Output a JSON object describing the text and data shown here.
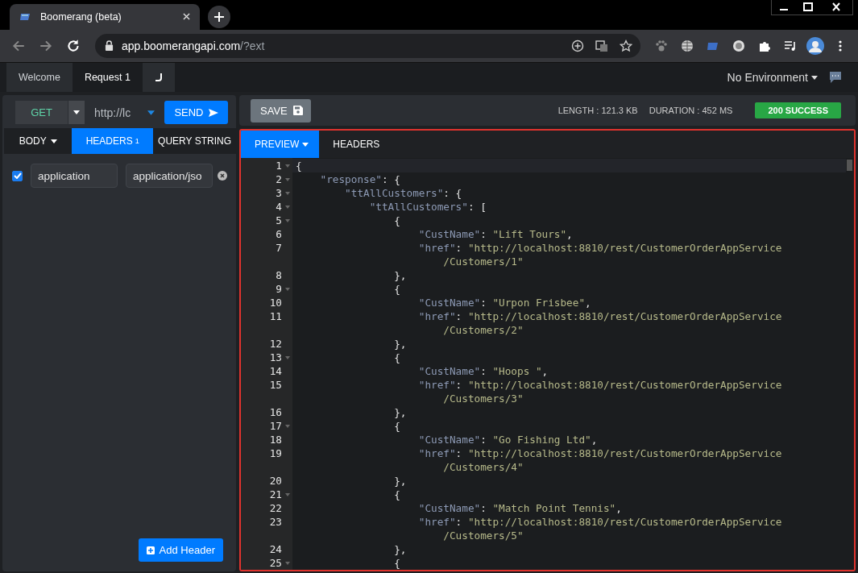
{
  "browser": {
    "tab_title": "Boomerang (beta)",
    "url_host": "app.boomerangapi.com",
    "url_path": "/?ext"
  },
  "app_tabs": [
    {
      "label": "Welcome",
      "selected": false
    },
    {
      "label": "Request 1",
      "selected": true
    }
  ],
  "environment": "No Environment",
  "request": {
    "method": "GET",
    "url": "http://lc",
    "send": "SEND",
    "tabs": [
      {
        "label": "BODY",
        "kind": "dropdown",
        "selected": false
      },
      {
        "label": "HEADERS",
        "kind": "count",
        "count": "1",
        "selected": true
      },
      {
        "label": "QUERY STRING",
        "kind": "plain",
        "selected": false
      }
    ],
    "headers": [
      {
        "checked": true,
        "name": "application",
        "value": "application/jso"
      }
    ],
    "add_header": "Add Header"
  },
  "response": {
    "save": "SAVE",
    "length": "LENGTH : 121.3 KB",
    "duration": "DURATION : 452 MS",
    "status": "200 SUCCESS",
    "tabs": [
      {
        "label": "PREVIEW",
        "selected": true
      },
      {
        "label": "HEADERS",
        "selected": false
      }
    ],
    "lines": [
      {
        "number": "1",
        "fold": true,
        "tokens": [
          {
            "kind": "punct",
            "text": "{"
          }
        ]
      },
      {
        "number": "2",
        "fold": true,
        "tokens": [
          {
            "kind": "key",
            "text": "    \"response\""
          },
          {
            "kind": "punct",
            "text": ": {"
          }
        ]
      },
      {
        "number": "3",
        "fold": true,
        "tokens": [
          {
            "kind": "key",
            "text": "        \"ttAllCustomers\""
          },
          {
            "kind": "punct",
            "text": ": {"
          }
        ]
      },
      {
        "number": "4",
        "fold": true,
        "tokens": [
          {
            "kind": "key",
            "text": "            \"ttAllCustomers\""
          },
          {
            "kind": "punct",
            "text": ": ["
          }
        ]
      },
      {
        "number": "5",
        "fold": true,
        "tokens": [
          {
            "kind": "punct",
            "text": "                {"
          }
        ]
      },
      {
        "number": "6",
        "fold": false,
        "tokens": [
          {
            "kind": "key",
            "text": "                    \"CustName\""
          },
          {
            "kind": "punct",
            "text": ": "
          },
          {
            "kind": "str",
            "text": "\"Lift Tours\""
          },
          {
            "kind": "punct",
            "text": ","
          }
        ]
      },
      {
        "number": "7",
        "fold": false,
        "tokens": [
          {
            "kind": "key",
            "text": "                    \"href\""
          },
          {
            "kind": "punct",
            "text": ": "
          },
          {
            "kind": "str",
            "text": "\"http://localhost:8810/rest/CustomerOrderAppService"
          }
        ]
      },
      {
        "fold": false,
        "tokens": [
          {
            "kind": "str",
            "text": "                        /Customers/1\""
          }
        ]
      },
      {
        "number": "8",
        "fold": false,
        "tokens": [
          {
            "kind": "punct",
            "text": "                },"
          }
        ]
      },
      {
        "number": "9",
        "fold": true,
        "tokens": [
          {
            "kind": "punct",
            "text": "                {"
          }
        ]
      },
      {
        "number": "10",
        "fold": false,
        "tokens": [
          {
            "kind": "key",
            "text": "                    \"CustName\""
          },
          {
            "kind": "punct",
            "text": ": "
          },
          {
            "kind": "str",
            "text": "\"Urpon Frisbee\""
          },
          {
            "kind": "punct",
            "text": ","
          }
        ]
      },
      {
        "number": "11",
        "fold": false,
        "tokens": [
          {
            "kind": "key",
            "text": "                    \"href\""
          },
          {
            "kind": "punct",
            "text": ": "
          },
          {
            "kind": "str",
            "text": "\"http://localhost:8810/rest/CustomerOrderAppService"
          }
        ]
      },
      {
        "fold": false,
        "tokens": [
          {
            "kind": "str",
            "text": "                        /Customers/2\""
          }
        ]
      },
      {
        "number": "12",
        "fold": false,
        "tokens": [
          {
            "kind": "punct",
            "text": "                },"
          }
        ]
      },
      {
        "number": "13",
        "fold": true,
        "tokens": [
          {
            "kind": "punct",
            "text": "                {"
          }
        ]
      },
      {
        "number": "14",
        "fold": false,
        "tokens": [
          {
            "kind": "key",
            "text": "                    \"CustName\""
          },
          {
            "kind": "punct",
            "text": ": "
          },
          {
            "kind": "str",
            "text": "\"Hoops \""
          },
          {
            "kind": "punct",
            "text": ","
          }
        ]
      },
      {
        "number": "15",
        "fold": false,
        "tokens": [
          {
            "kind": "key",
            "text": "                    \"href\""
          },
          {
            "kind": "punct",
            "text": ": "
          },
          {
            "kind": "str",
            "text": "\"http://localhost:8810/rest/CustomerOrderAppService"
          }
        ]
      },
      {
        "fold": false,
        "tokens": [
          {
            "kind": "str",
            "text": "                        /Customers/3\""
          }
        ]
      },
      {
        "number": "16",
        "fold": false,
        "tokens": [
          {
            "kind": "punct",
            "text": "                },"
          }
        ]
      },
      {
        "number": "17",
        "fold": true,
        "tokens": [
          {
            "kind": "punct",
            "text": "                {"
          }
        ]
      },
      {
        "number": "18",
        "fold": false,
        "tokens": [
          {
            "kind": "key",
            "text": "                    \"CustName\""
          },
          {
            "kind": "punct",
            "text": ": "
          },
          {
            "kind": "str",
            "text": "\"Go Fishing Ltd\""
          },
          {
            "kind": "punct",
            "text": ","
          }
        ]
      },
      {
        "number": "19",
        "fold": false,
        "tokens": [
          {
            "kind": "key",
            "text": "                    \"href\""
          },
          {
            "kind": "punct",
            "text": ": "
          },
          {
            "kind": "str",
            "text": "\"http://localhost:8810/rest/CustomerOrderAppService"
          }
        ]
      },
      {
        "fold": false,
        "tokens": [
          {
            "kind": "str",
            "text": "                        /Customers/4\""
          }
        ]
      },
      {
        "number": "20",
        "fold": false,
        "tokens": [
          {
            "kind": "punct",
            "text": "                },"
          }
        ]
      },
      {
        "number": "21",
        "fold": true,
        "tokens": [
          {
            "kind": "punct",
            "text": "                {"
          }
        ]
      },
      {
        "number": "22",
        "fold": false,
        "tokens": [
          {
            "kind": "key",
            "text": "                    \"CustName\""
          },
          {
            "kind": "punct",
            "text": ": "
          },
          {
            "kind": "str",
            "text": "\"Match Point Tennis\""
          },
          {
            "kind": "punct",
            "text": ","
          }
        ]
      },
      {
        "number": "23",
        "fold": false,
        "tokens": [
          {
            "kind": "key",
            "text": "                    \"href\""
          },
          {
            "kind": "punct",
            "text": ": "
          },
          {
            "kind": "str",
            "text": "\"http://localhost:8810/rest/CustomerOrderAppService"
          }
        ]
      },
      {
        "fold": false,
        "tokens": [
          {
            "kind": "str",
            "text": "                        /Customers/5\""
          }
        ]
      },
      {
        "number": "24",
        "fold": false,
        "tokens": [
          {
            "kind": "punct",
            "text": "                },"
          }
        ]
      },
      {
        "number": "25",
        "fold": true,
        "tokens": [
          {
            "kind": "punct",
            "text": "                {"
          }
        ]
      }
    ]
  }
}
